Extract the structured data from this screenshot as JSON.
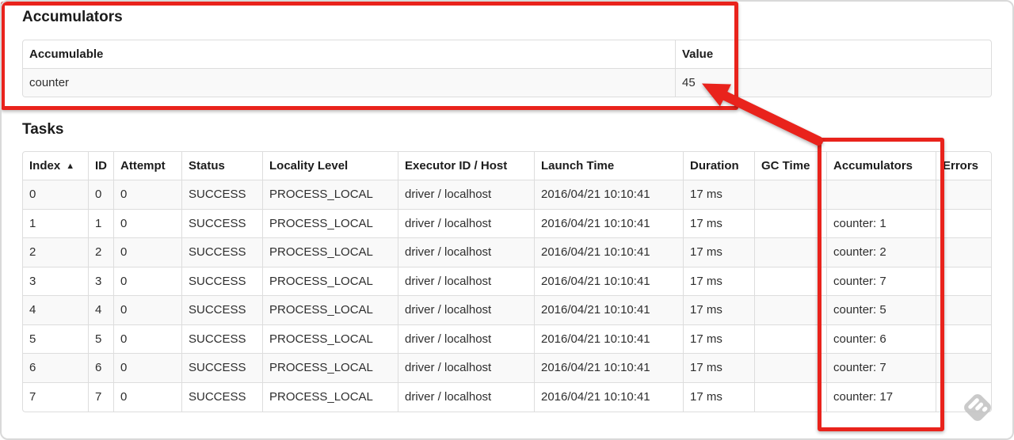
{
  "accumulators_section": {
    "title": "Accumulators",
    "table": {
      "columns": [
        "Accumulable",
        "Value"
      ],
      "keys": [
        "accumulable",
        "value"
      ],
      "rows": [
        {
          "accumulable": "counter",
          "value": "45"
        }
      ]
    }
  },
  "tasks_section": {
    "title": "Tasks",
    "table": {
      "columns": [
        "Index",
        "ID",
        "Attempt",
        "Status",
        "Locality Level",
        "Executor ID / Host",
        "Launch Time",
        "Duration",
        "GC Time",
        "Accumulators",
        "Errors"
      ],
      "keys": [
        "index",
        "id",
        "attempt",
        "status",
        "locality_level",
        "executor_id_host",
        "launch_time",
        "duration",
        "gc_time",
        "accumulators",
        "errors"
      ],
      "sort_column": "Index",
      "sort_icon": "▲",
      "rows": [
        {
          "index": "0",
          "id": "0",
          "attempt": "0",
          "status": "SUCCESS",
          "locality_level": "PROCESS_LOCAL",
          "executor_id_host": "driver / localhost",
          "launch_time": "2016/04/21 10:10:41",
          "duration": "17 ms",
          "gc_time": "",
          "accumulators": "",
          "errors": ""
        },
        {
          "index": "1",
          "id": "1",
          "attempt": "0",
          "status": "SUCCESS",
          "locality_level": "PROCESS_LOCAL",
          "executor_id_host": "driver / localhost",
          "launch_time": "2016/04/21 10:10:41",
          "duration": "17 ms",
          "gc_time": "",
          "accumulators": "counter: 1",
          "errors": ""
        },
        {
          "index": "2",
          "id": "2",
          "attempt": "0",
          "status": "SUCCESS",
          "locality_level": "PROCESS_LOCAL",
          "executor_id_host": "driver / localhost",
          "launch_time": "2016/04/21 10:10:41",
          "duration": "17 ms",
          "gc_time": "",
          "accumulators": "counter: 2",
          "errors": ""
        },
        {
          "index": "3",
          "id": "3",
          "attempt": "0",
          "status": "SUCCESS",
          "locality_level": "PROCESS_LOCAL",
          "executor_id_host": "driver / localhost",
          "launch_time": "2016/04/21 10:10:41",
          "duration": "17 ms",
          "gc_time": "",
          "accumulators": "counter: 7",
          "errors": ""
        },
        {
          "index": "4",
          "id": "4",
          "attempt": "0",
          "status": "SUCCESS",
          "locality_level": "PROCESS_LOCAL",
          "executor_id_host": "driver / localhost",
          "launch_time": "2016/04/21 10:10:41",
          "duration": "17 ms",
          "gc_time": "",
          "accumulators": "counter: 5",
          "errors": ""
        },
        {
          "index": "5",
          "id": "5",
          "attempt": "0",
          "status": "SUCCESS",
          "locality_level": "PROCESS_LOCAL",
          "executor_id_host": "driver / localhost",
          "launch_time": "2016/04/21 10:10:41",
          "duration": "17 ms",
          "gc_time": "",
          "accumulators": "counter: 6",
          "errors": ""
        },
        {
          "index": "6",
          "id": "6",
          "attempt": "0",
          "status": "SUCCESS",
          "locality_level": "PROCESS_LOCAL",
          "executor_id_host": "driver / localhost",
          "launch_time": "2016/04/21 10:10:41",
          "duration": "17 ms",
          "gc_time": "",
          "accumulators": "counter: 7",
          "errors": ""
        },
        {
          "index": "7",
          "id": "7",
          "attempt": "0",
          "status": "SUCCESS",
          "locality_level": "PROCESS_LOCAL",
          "executor_id_host": "driver / localhost",
          "launch_time": "2016/04/21 10:10:41",
          "duration": "17 ms",
          "gc_time": "",
          "accumulators": "counter: 17",
          "errors": ""
        }
      ]
    }
  },
  "annotations": {
    "highlight_color": "#e9231c",
    "box1_target": "accumulators-summary-table",
    "box2_target": "tasks-accumulators-column",
    "arrow_points_to": "45"
  },
  "theme": {
    "red": "#e9231c",
    "stripe": "#f9f9f9",
    "table_border": "#dddddd",
    "text": "#2e2e2e",
    "heading_text": "#1b1b1b",
    "watermark_gray": "#c6c6c6",
    "frame_border": "#d9d9d9",
    "page_bg": "#ffffff"
  }
}
